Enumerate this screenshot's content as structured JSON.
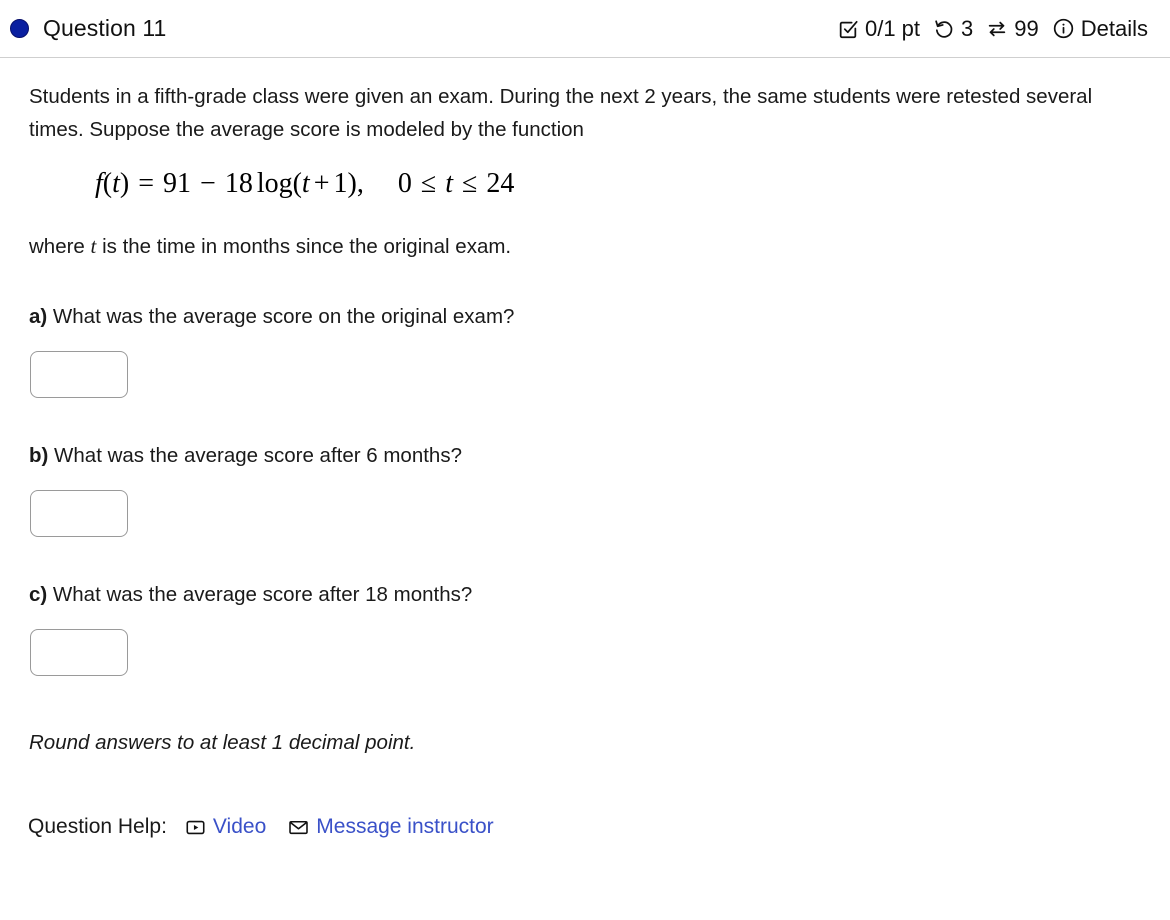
{
  "header": {
    "status_icon": "filled-circle-icon",
    "status_color": "#0a1fa0",
    "title": "Question 11",
    "score": "0/1 pt",
    "score_icon": "checkbox-checked-icon",
    "attempts": "3",
    "attempts_icon": "rotate-left-icon",
    "versions": "99",
    "versions_icon": "exchange-arrows-icon",
    "details_label": "Details",
    "details_icon": "info-circle-icon"
  },
  "question": {
    "stem": "Students in a fifth-grade class were given an exam. During the next 2 years, the same students were retested several times. Suppose the average score is modeled by the function",
    "formula": {
      "fn": "f",
      "arg": "t",
      "equals": "=",
      "constant": "91",
      "minus": "−",
      "coefficient": "18",
      "log": "log",
      "inner": "t",
      "plus": "+",
      "inner_constant": "1",
      "comma": ",",
      "domain_low": "0",
      "le1": "≤",
      "domain_var": "t",
      "le2": "≤",
      "domain_high": "24",
      "plain": "f(t) = 91 − 18 log(t + 1),   0 ≤ t ≤ 24"
    },
    "where_prefix": "where ",
    "where_var": "t",
    "where_suffix": " is the time in months since the original exam.",
    "parts": [
      {
        "label": "a)",
        "text": " What was the average score on the original exam?",
        "answer_value": "",
        "answer_placeholder": ""
      },
      {
        "label": "b)",
        "text": " What was the average score after 6 months?",
        "answer_value": "",
        "answer_placeholder": ""
      },
      {
        "label": "c)",
        "text": " What was the average score after 18 months?",
        "answer_value": "",
        "answer_placeholder": ""
      }
    ],
    "round_note": "Round answers to at least 1 decimal point."
  },
  "help": {
    "label": "Question Help:",
    "video_label": "Video",
    "video_icon": "video-play-icon",
    "message_label": "Message instructor",
    "message_icon": "envelope-icon",
    "link_color": "#3a51c8"
  }
}
